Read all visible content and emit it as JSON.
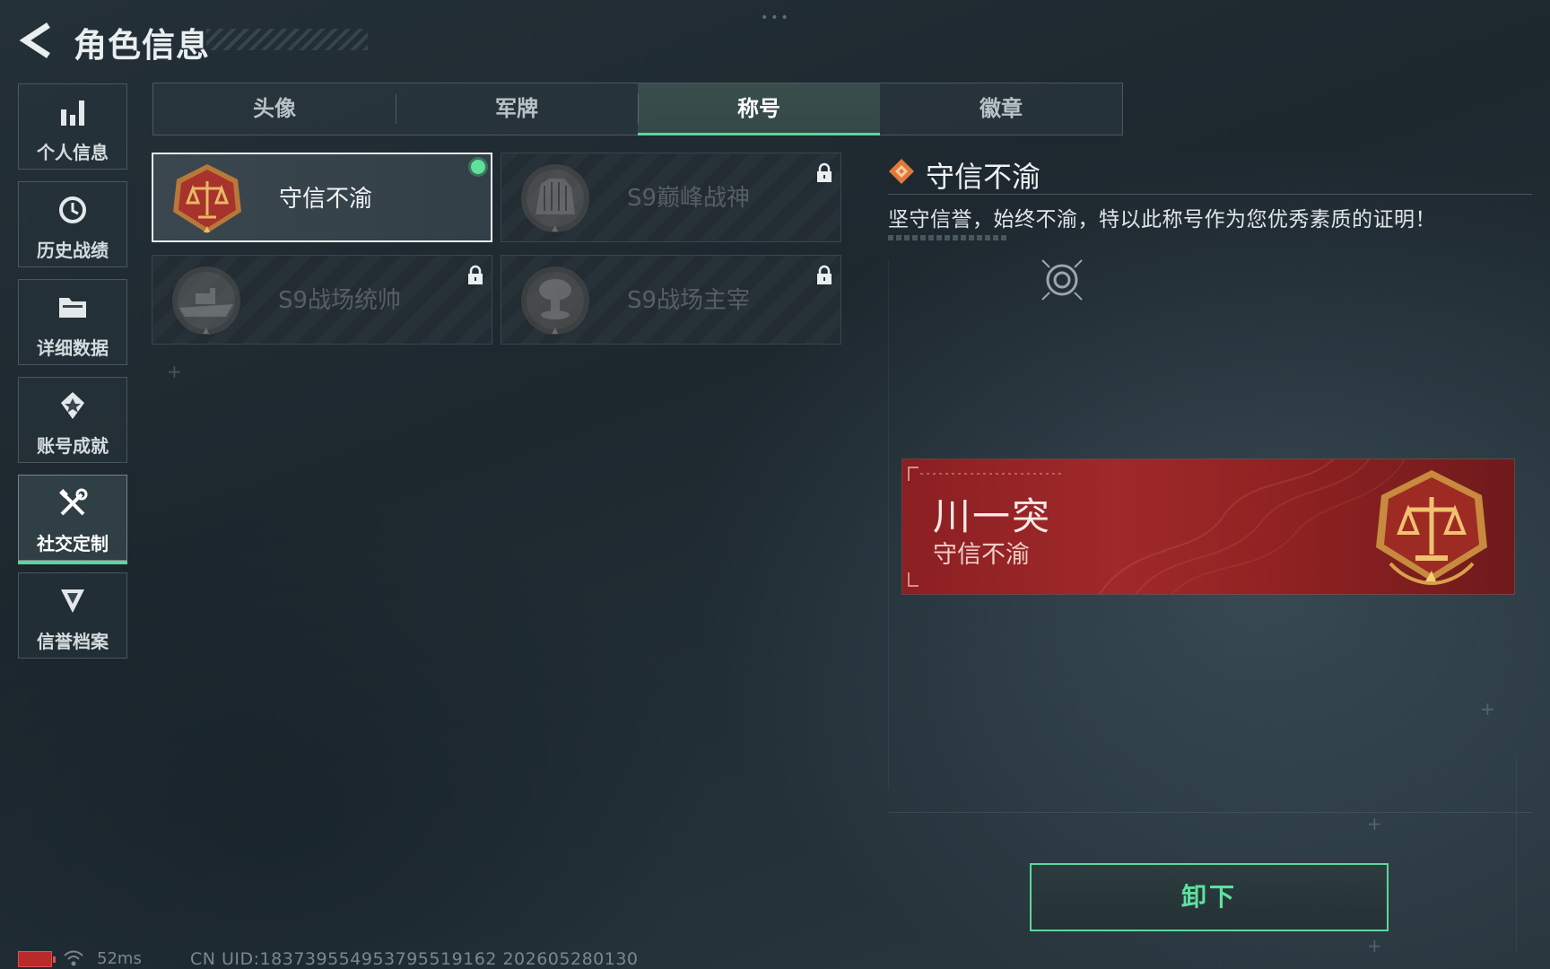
{
  "header": {
    "back_icon": "back-arrow-icon",
    "title": "角色信息"
  },
  "sidebar": {
    "items": [
      {
        "label": "个人信息",
        "icon": "bar-chart-icon",
        "active": false
      },
      {
        "label": "历史战绩",
        "icon": "history-clock-icon",
        "active": false
      },
      {
        "label": "详细数据",
        "icon": "folder-icon",
        "active": false
      },
      {
        "label": "账号成就",
        "icon": "achievement-badge-icon",
        "active": false
      },
      {
        "label": "社交定制",
        "icon": "tools-icon",
        "active": true
      },
      {
        "label": "信誉档案",
        "icon": "credit-shield-icon",
        "active": false
      }
    ]
  },
  "tabs": [
    {
      "label": "头像",
      "active": false
    },
    {
      "label": "军牌",
      "active": false
    },
    {
      "label": "称号",
      "active": true
    },
    {
      "label": "徽章",
      "active": false
    }
  ],
  "titles": [
    {
      "label": "守信不渝",
      "medal": "scales-medal-icon",
      "selected": true,
      "equipped": true,
      "locked": false
    },
    {
      "label": "S9巅峰战神",
      "medal": "fortress-medal-icon",
      "selected": false,
      "equipped": false,
      "locked": true
    },
    {
      "label": "S9战场统帅",
      "medal": "warship-medal-icon",
      "selected": false,
      "equipped": false,
      "locked": true
    },
    {
      "label": "S9战场主宰",
      "medal": "mushroom-cloud-medal-icon",
      "selected": false,
      "equipped": false,
      "locked": true
    }
  ],
  "detail": {
    "icon": "diamond-title-icon",
    "title": "守信不渝",
    "description": "坚守信誉，始终不渝，特以此称号作为您优秀素质的证明！",
    "preview_icon": "view-target-icon"
  },
  "preview": {
    "player_name": "川一突",
    "title": "守信不渝",
    "medal": "scales-medal-icon",
    "color": "#a0292a"
  },
  "action": {
    "unequip_label": "卸下"
  },
  "status": {
    "ping": "52ms",
    "uid": "CN UID:1837395549537955191​62 202605280130"
  },
  "colors": {
    "accent": "#5fd59b",
    "banner_red": "#a0292a",
    "medal_gold": "#d9a04a"
  }
}
